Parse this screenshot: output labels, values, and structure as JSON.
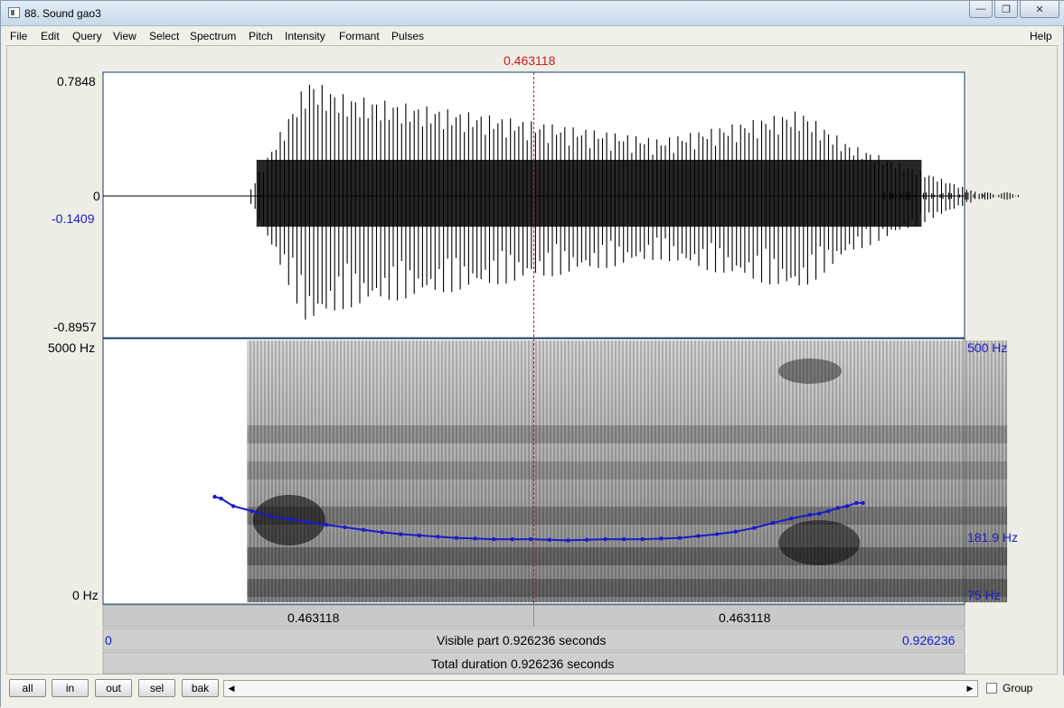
{
  "window": {
    "title": "88. Sound gao3"
  },
  "menu": [
    "File",
    "Edit",
    "Query",
    "View",
    "Select",
    "Spectrum",
    "Pitch",
    "Intensity",
    "Formant",
    "Pulses"
  ],
  "help_label": "Help",
  "cursor": {
    "time_label": "0.463118",
    "time": 0.463118
  },
  "waveform": {
    "max_label": "0.7848",
    "zero_label": "0",
    "min_label": "-0.8957",
    "cursor_value_label": "-0.1409"
  },
  "spectrogram": {
    "max_freq_label": "5000 Hz",
    "min_freq_label": "0 Hz"
  },
  "pitch": {
    "max_label": "500 Hz",
    "min_label": "75 Hz",
    "cursor_label": "181.9 Hz",
    "range_hz": [
      75,
      500
    ],
    "contour": [
      [
        0.12,
        247
      ],
      [
        0.127,
        244
      ],
      [
        0.14,
        232
      ],
      [
        0.16,
        224
      ],
      [
        0.18,
        216
      ],
      [
        0.2,
        211
      ],
      [
        0.22,
        206
      ],
      [
        0.24,
        202
      ],
      [
        0.26,
        198
      ],
      [
        0.28,
        194
      ],
      [
        0.3,
        190
      ],
      [
        0.32,
        187
      ],
      [
        0.34,
        185
      ],
      [
        0.36,
        183
      ],
      [
        0.38,
        181
      ],
      [
        0.4,
        180
      ],
      [
        0.42,
        179
      ],
      [
        0.44,
        179
      ],
      [
        0.46,
        179
      ],
      [
        0.48,
        178
      ],
      [
        0.5,
        177
      ],
      [
        0.52,
        178
      ],
      [
        0.54,
        179
      ],
      [
        0.56,
        179
      ],
      [
        0.58,
        179
      ],
      [
        0.6,
        180
      ],
      [
        0.62,
        181
      ],
      [
        0.64,
        184
      ],
      [
        0.66,
        187
      ],
      [
        0.68,
        191
      ],
      [
        0.7,
        197
      ],
      [
        0.72,
        205
      ],
      [
        0.74,
        212
      ],
      [
        0.76,
        218
      ],
      [
        0.77,
        220
      ],
      [
        0.78,
        224
      ],
      [
        0.79,
        229
      ],
      [
        0.8,
        232
      ],
      [
        0.81,
        237
      ],
      [
        0.817,
        237
      ]
    ]
  },
  "time_axis": {
    "left_segment_label": "0.463118",
    "right_segment_label": "0.463118",
    "start_label": "0",
    "end_label": "0.926236",
    "visible_label": "Visible part 0.926236 seconds",
    "total_label": "Total duration 0.926236 seconds",
    "visible_duration": 0.926236
  },
  "buttons": {
    "all": "all",
    "in": "in",
    "out": "out",
    "sel": "sel",
    "bak": "bak"
  },
  "group_label": "Group",
  "colors": {
    "cursor": "#cc1a1a",
    "pitch": "#1a1acc",
    "axis_label_blue": "#1a1acc"
  }
}
